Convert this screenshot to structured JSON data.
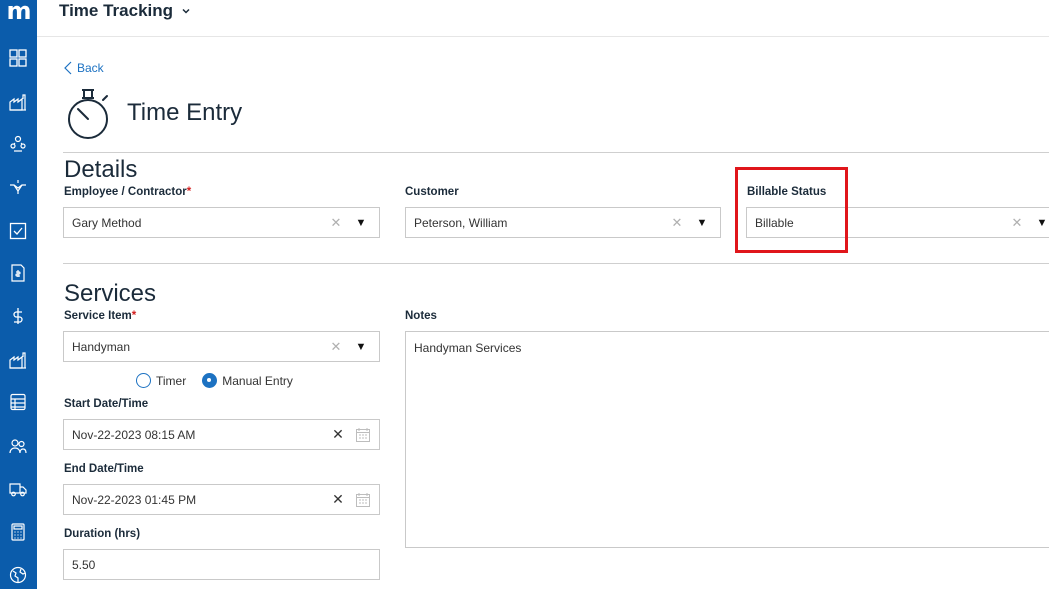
{
  "app": {
    "logo": "m",
    "title": "Time Tracking"
  },
  "sidebar": {
    "items": [
      {
        "icon": "dashboard-icon"
      },
      {
        "icon": "factory-icon"
      },
      {
        "icon": "team-icon"
      },
      {
        "icon": "handshake-icon"
      },
      {
        "icon": "checkbox-icon"
      },
      {
        "icon": "invoice-icon"
      },
      {
        "icon": "dollar-icon"
      },
      {
        "icon": "factory-icon"
      },
      {
        "icon": "ledger-icon"
      },
      {
        "icon": "people-icon"
      },
      {
        "icon": "truck-icon"
      },
      {
        "icon": "calculator-icon"
      },
      {
        "icon": "globe-icon"
      }
    ]
  },
  "page": {
    "back_label": "Back",
    "title": "Time Entry",
    "icon": "stopwatch-icon"
  },
  "details": {
    "section_title": "Details",
    "employee": {
      "label": "Employee / Contractor",
      "required": "*",
      "value": "Gary Method"
    },
    "customer": {
      "label": "Customer",
      "value": "Peterson, William"
    },
    "billable": {
      "label": "Billable Status",
      "value": "Billable"
    }
  },
  "services": {
    "section_title": "Services",
    "service_item": {
      "label": "Service Item",
      "required": "*",
      "value": "Handyman"
    },
    "mode": {
      "timer_label": "Timer",
      "manual_label": "Manual Entry",
      "selected": "Manual Entry"
    },
    "start": {
      "label": "Start Date/Time",
      "value": "Nov-22-2023 08:15 AM"
    },
    "end": {
      "label": "End Date/Time",
      "value": "Nov-22-2023 01:45 PM"
    },
    "duration": {
      "label": "Duration (hrs)",
      "value": "5.50"
    },
    "notes": {
      "label": "Notes",
      "value": "Handyman Services"
    }
  },
  "colors": {
    "sidebar": "#0b5cab",
    "accent": "#1d72c2",
    "highlight": "#e0161b",
    "required": "#d32020"
  }
}
